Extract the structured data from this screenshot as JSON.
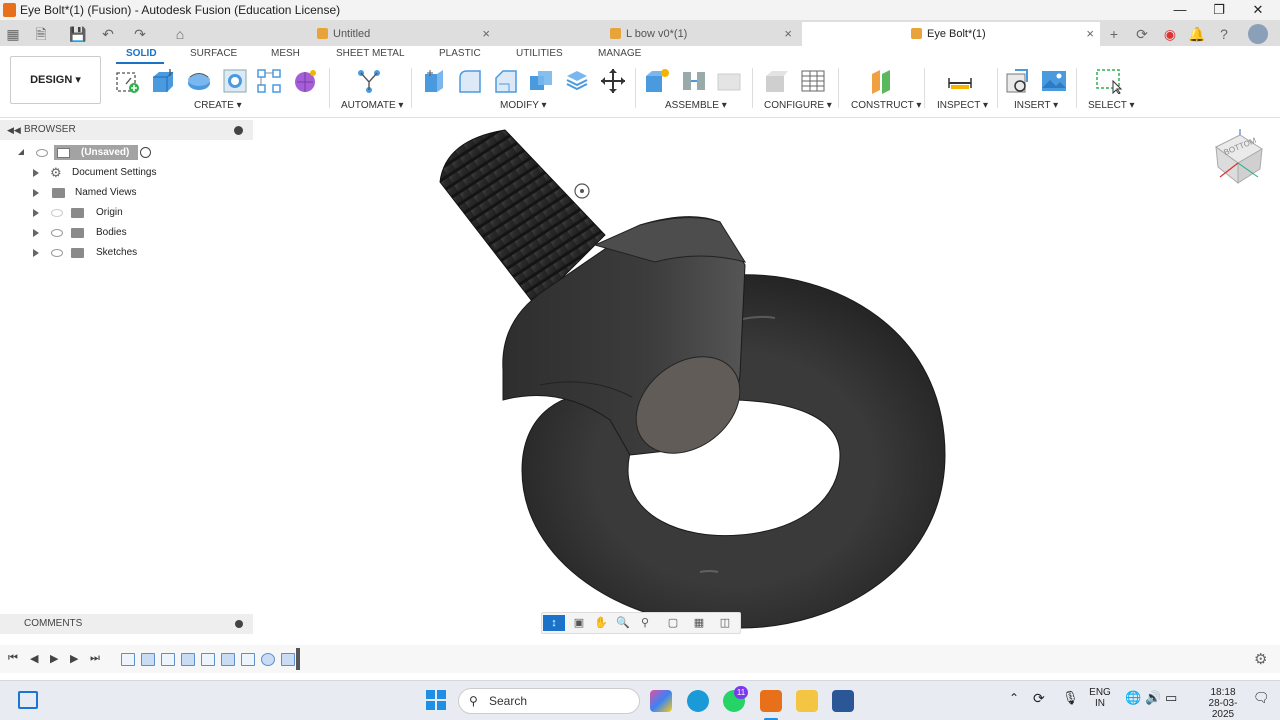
{
  "window": {
    "title": "Eye Bolt*(1) (Fusion) - Autodesk Fusion (Education License)",
    "minimize": "—",
    "restore": "❐",
    "close": "✕"
  },
  "tabs": [
    {
      "label": "Untitled",
      "active": false
    },
    {
      "label": "L bow v0*(1)",
      "active": false
    },
    {
      "label": "Eye Bolt*(1)",
      "active": true
    }
  ],
  "ribbon": {
    "workspace": "DESIGN",
    "tabs": [
      "SOLID",
      "SURFACE",
      "MESH",
      "SHEET METAL",
      "PLASTIC",
      "UTILITIES",
      "MANAGE"
    ],
    "groups": [
      "CREATE",
      "AUTOMATE",
      "MODIFY",
      "ASSEMBLE",
      "CONFIGURE",
      "CONSTRUCT",
      "INSPECT",
      "INSERT",
      "SELECT"
    ],
    "accent": "#1a73c8"
  },
  "browser": {
    "header": "BROWSER",
    "root": "(Unsaved)",
    "items": [
      "Document Settings",
      "Named Views",
      "Origin",
      "Bodies",
      "Sketches"
    ]
  },
  "comments": {
    "label": "COMMENTS"
  },
  "viewcube": {
    "face": "BOTTOM"
  },
  "taskbar": {
    "search": "Search",
    "whatsapp_badge": "11",
    "lang": "ENG",
    "region": "IN",
    "time": "18:18",
    "date": "28-03-2025"
  }
}
